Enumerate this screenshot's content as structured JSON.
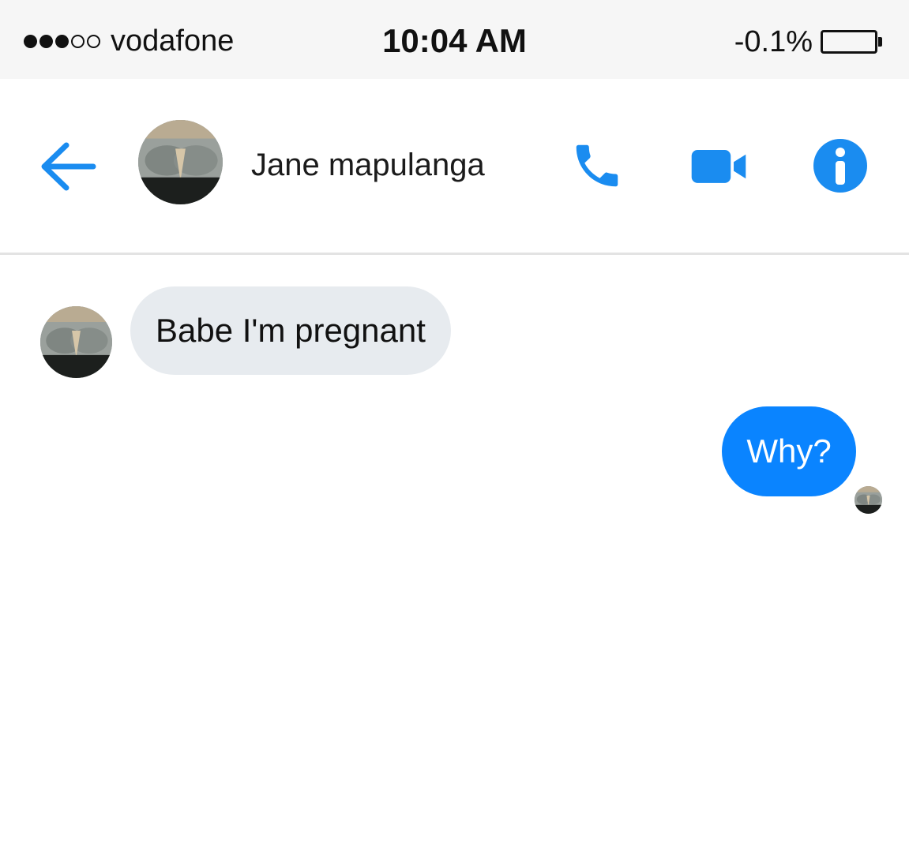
{
  "status_bar": {
    "signal": {
      "filled": 3,
      "empty": 2
    },
    "carrier": "vodafone",
    "time": "10:04 AM",
    "battery_percent": "-0.1%"
  },
  "header": {
    "back_icon": "arrow-left-icon",
    "contact_name": "Jane mapulanga",
    "actions": [
      {
        "icon": "phone-icon"
      },
      {
        "icon": "video-camera-icon"
      },
      {
        "icon": "info-icon"
      }
    ],
    "accent_color": "#1a8cf0"
  },
  "messages": [
    {
      "direction": "incoming",
      "text": "Babe I'm pregnant"
    },
    {
      "direction": "outgoing",
      "text": "Why?"
    }
  ],
  "colors": {
    "outgoing_bubble": "#0a84ff",
    "incoming_bubble": "#e7ebef"
  }
}
